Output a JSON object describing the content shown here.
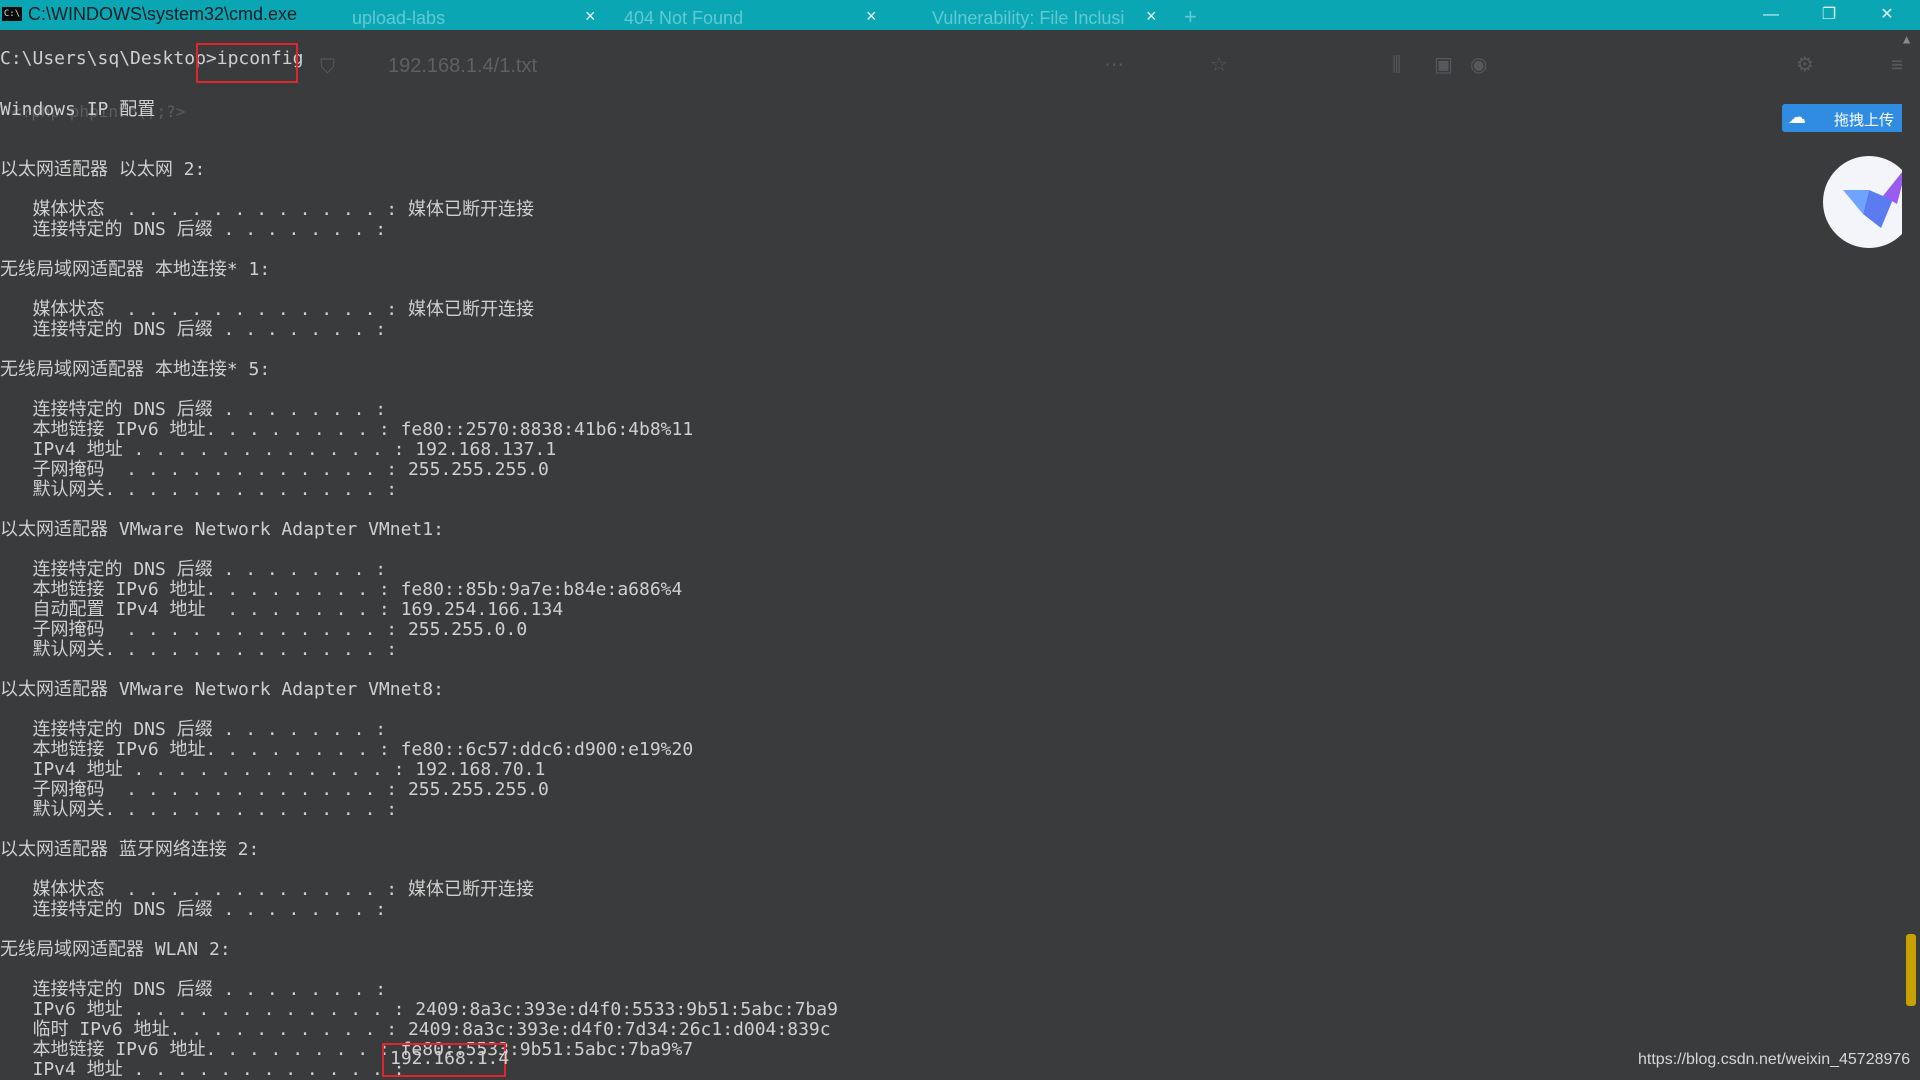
{
  "titlebar": {
    "icon_text": "C:\\",
    "title": "C:\\WINDOWS\\system32\\cmd.exe",
    "bg_tabs": [
      "upload-labs",
      "404 Not Found",
      "Vulnerability: File Inclusi"
    ],
    "new_tab": "+",
    "close_glyph": "×",
    "controls": {
      "minimize": "—",
      "restore": "❐",
      "close": "✕"
    }
  },
  "browser": {
    "url": "192.168.1.4/1.txt",
    "php_snippet": "<?php phpinfo();?>"
  },
  "console": {
    "prompt": "C:\\Users\\sq\\Desktop>",
    "command": "ipconfig",
    "lines": [
      "Windows IP 配置",
      "",
      "",
      "以太网适配器 以太网 2:",
      "",
      "   媒体状态  . . . . . . . . . . . . : 媒体已断开连接",
      "   连接特定的 DNS 后缀 . . . . . . . :",
      "",
      "无线局域网适配器 本地连接* 1:",
      "",
      "   媒体状态  . . . . . . . . . . . . : 媒体已断开连接",
      "   连接特定的 DNS 后缀 . . . . . . . :",
      "",
      "无线局域网适配器 本地连接* 5:",
      "",
      "   连接特定的 DNS 后缀 . . . . . . . :",
      "   本地链接 IPv6 地址. . . . . . . . : fe80::2570:8838:41b6:4b8%11",
      "   IPv4 地址 . . . . . . . . . . . . : 192.168.137.1",
      "   子网掩码  . . . . . . . . . . . . : 255.255.255.0",
      "   默认网关. . . . . . . . . . . . . :",
      "",
      "以太网适配器 VMware Network Adapter VMnet1:",
      "",
      "   连接特定的 DNS 后缀 . . . . . . . :",
      "   本地链接 IPv6 地址. . . . . . . . : fe80::85b:9a7e:b84e:a686%4",
      "   自动配置 IPv4 地址  . . . . . . . : 169.254.166.134",
      "   子网掩码  . . . . . . . . . . . . : 255.255.0.0",
      "   默认网关. . . . . . . . . . . . . :",
      "",
      "以太网适配器 VMware Network Adapter VMnet8:",
      "",
      "   连接特定的 DNS 后缀 . . . . . . . :",
      "   本地链接 IPv6 地址. . . . . . . . : fe80::6c57:ddc6:d900:e19%20",
      "   IPv4 地址 . . . . . . . . . . . . : 192.168.70.1",
      "   子网掩码  . . . . . . . . . . . . : 255.255.255.0",
      "   默认网关. . . . . . . . . . . . . :",
      "",
      "以太网适配器 蓝牙网络连接 2:",
      "",
      "   媒体状态  . . . . . . . . . . . . : 媒体已断开连接",
      "   连接特定的 DNS 后缀 . . . . . . . :",
      "",
      "无线局域网适配器 WLAN 2:",
      "",
      "   连接特定的 DNS 后缀 . . . . . . . :",
      "   IPv6 地址 . . . . . . . . . . . . : 2409:8a3c:393e:d4f0:5533:9b51:5abc:7ba9",
      "   临时 IPv6 地址. . . . . . . . . . : 2409:8a3c:393e:d4f0:7d34:26c1:d004:839c",
      "   本地链接 IPv6 地址. . . . . . . . : fe80::5533:9b51:5abc:7ba9%7",
      "   IPv4 地址 . . . . . . . . . . . . :"
    ],
    "highlighted_ip": "192.168.1.4"
  },
  "upload_widget": {
    "label": "拖拽上传"
  },
  "watermark": "https://blog.csdn.net/weixin_45728976"
}
